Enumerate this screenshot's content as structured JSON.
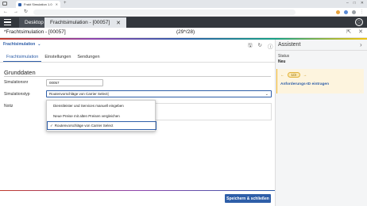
{
  "browser": {
    "tab_title": "Frakt Simulation 1.0",
    "url": "",
    "new_tab_icon": "plus-icon",
    "window_controls": [
      "‒",
      "□",
      "✕"
    ]
  },
  "app": {
    "menu_icon": "hamburger-icon",
    "tabs": [
      {
        "label": "Desktop"
      },
      {
        "label": "Frachtsimulation - [00057]"
      }
    ],
    "account_icon": "info-circle-icon"
  },
  "title_row": {
    "title": "*Frachtsimulation - [00057]",
    "counter": "(29*/28)"
  },
  "context": {
    "label": "Frachtsimulation"
  },
  "form_tabs": [
    {
      "label": "Frachtsimulation"
    },
    {
      "label": "Einstellungen"
    },
    {
      "label": "Sendungen"
    }
  ],
  "section": {
    "title": "Grunddaten"
  },
  "fields": {
    "simulationsnr_label": "Simulationsnr",
    "simulationsnr_value": "00057",
    "simulationstyp_label": "Simulationstyp",
    "simulationstyp_value": "Routenvorschläge von Carrier Select|",
    "notiz_label": "Notiz"
  },
  "dropdown": {
    "options": [
      "Dienstleister und Services manuell eingeben",
      "Neue Preise mit alten Preisen vergleichen",
      "Routenvorschläge von Carrier Select"
    ],
    "selected_mark": "✓"
  },
  "footer": {
    "save_label": "Speichern & schließen"
  },
  "assistant": {
    "title": "Assistent",
    "status_label": "Status",
    "status_value": "Neu",
    "pager": "1/3",
    "link": "Anforderungs-ID eintragen"
  },
  "colors": {
    "accent": "#2e5ea8",
    "appbar": "#33373d",
    "card_bg": "#fdf4de",
    "card_border": "#f0b429"
  }
}
